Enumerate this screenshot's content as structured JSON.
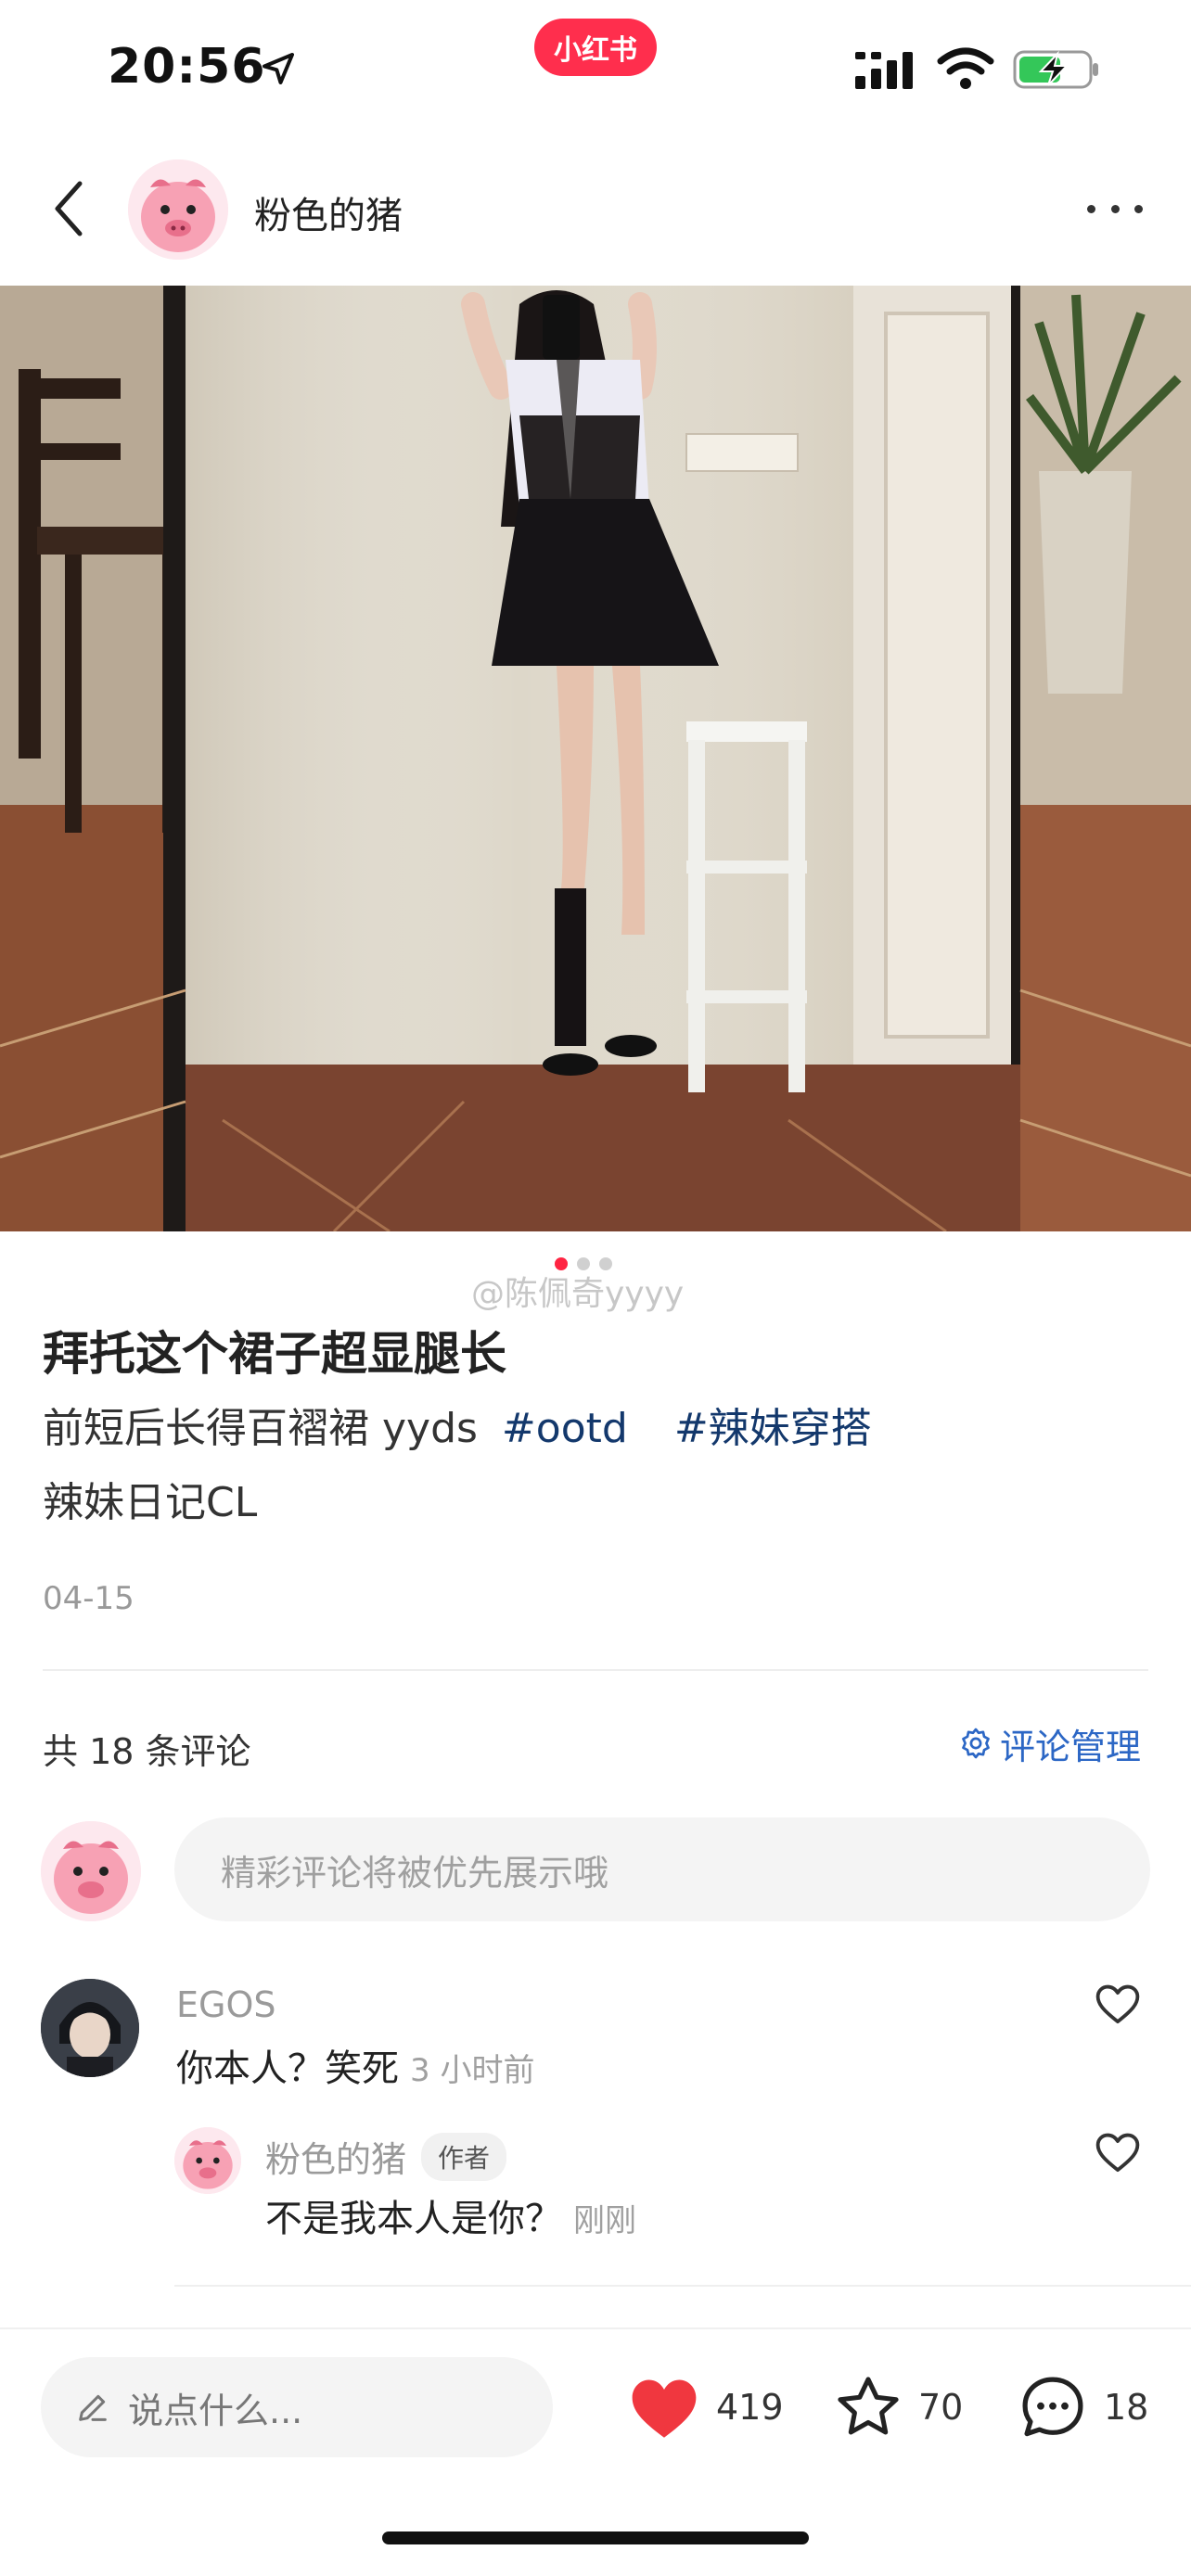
{
  "status_bar": {
    "time": "20:56",
    "app_badge": "小红书",
    "icons": [
      "location-arrow-icon",
      "cellular-signal-icon",
      "wifi-icon",
      "battery-charging-icon"
    ]
  },
  "header": {
    "author": "粉色的猪",
    "back_icon": "chevron-left-icon",
    "more_icon": "more-dots-icon"
  },
  "photo": {
    "watermark": "@陈佩奇yyyy",
    "page_dots": 3,
    "active_dot": 1
  },
  "post": {
    "title": "拜托这个裙子超显腿长",
    "desc_text": "前短后长得百褶裙 yyds",
    "tags": [
      "#ootd",
      "#辣妹穿搭"
    ],
    "line2": "辣妹日记CL",
    "date": "04-15"
  },
  "comments_section": {
    "count_label": "共 18 条评论",
    "manage_label": "评论管理",
    "input_placeholder": "精彩评论将被优先展示哦"
  },
  "comments": [
    {
      "user": "EGOS",
      "text": "你本人？笑死",
      "time": "3 小时前",
      "replies": [
        {
          "user": "粉色的猪",
          "tag": "作者",
          "text": "不是我本人是你？",
          "time": "刚刚"
        }
      ]
    }
  ],
  "bottom_bar": {
    "input_placeholder": "说点什么...",
    "likes": "419",
    "stars": "70",
    "comments": "18"
  },
  "colors": {
    "brand": "#ff2442",
    "hashtag": "#13386c",
    "link": "#2c67c5",
    "heart": "#f0373f"
  }
}
